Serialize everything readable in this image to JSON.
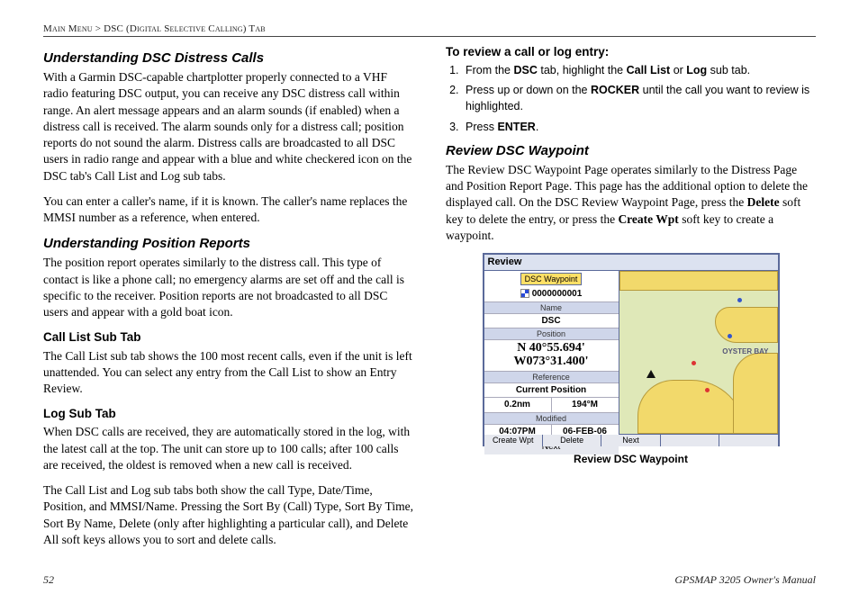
{
  "header": {
    "breadcrumb_pre": "Main Menu > ",
    "breadcrumb_main": "DSC (Digital Selective Calling) Tab"
  },
  "left": {
    "h_distress": "Understanding DSC Distress Calls",
    "p_distress1": "With a Garmin DSC-capable chartplotter properly connected to a VHF radio featuring DSC output, you can receive any DSC distress call within range. An alert message appears and an alarm sounds (if enabled) when a distress call is received. The alarm sounds only for a distress call; position reports do not sound the alarm. Distress calls are broadcasted to all DSC users in radio range and appear with a blue and white checkered icon on the DSC tab's Call List and Log sub tabs.",
    "p_distress2": "You can enter a caller's name, if it is known. The caller's name replaces the MMSI number as a reference, when entered.",
    "h_posrep": "Understanding Position Reports",
    "p_posrep": "The position report operates similarly to the distress call. This type of contact is like a phone call; no emergency alarms are set off and the call is specific to the receiver. Position reports are not broadcasted to all DSC users and appear with a gold boat icon.",
    "h_calllist": "Call List Sub Tab",
    "p_calllist": "The Call List sub tab shows the 100 most recent calls, even if the unit is left unattended. You can select any entry from the Call List to show an Entry Review.",
    "h_log": "Log Sub Tab",
    "p_log1": "When DSC calls are received, they are automatically stored in the log, with the latest call at the top. The unit can store up to 100 calls; after 100 calls are received, the oldest is removed when a new call is received.",
    "p_log2": "The Call List and Log sub tabs both show the call Type, Date/Time, Position, and MMSI/Name. Pressing the Sort By (Call) Type, Sort By Time, Sort By Name, Delete (only after highlighting a particular call), and Delete All soft keys allows you to sort and delete calls."
  },
  "right": {
    "h_review_proc": "To review a call or log entry:",
    "steps": [
      {
        "pre": "From the ",
        "b1": "DSC",
        "mid": " tab, highlight the ",
        "b2": "Call List",
        "mid2": " or ",
        "b3": "Log",
        "post": " sub tab."
      },
      {
        "pre": "Press up or down on the ",
        "b1": "ROCKER",
        "post": " until the call you want to review is highlighted."
      },
      {
        "pre": "Press ",
        "b1": "ENTER",
        "post": "."
      }
    ],
    "h_reviewwpt": "Review DSC Waypoint",
    "p_reviewwpt": "The Review DSC Waypoint Page operates similarly to the Distress Page and Position Report Page. This page has the additional option to delete the displayed call. On the DSC Review Waypoint Page, press the Delete soft key to delete the entry, or press the Create Wpt soft key to create a waypoint.",
    "p_reviewwpt_b1": "Delete",
    "p_reviewwpt_b2": "Create Wpt",
    "fig": {
      "title": "Review",
      "tab": "DSC  Waypoint",
      "mmsi": "0000000001",
      "lbl_name": "Name",
      "name": "DSC",
      "lbl_position": "Position",
      "pos_n": "N  40°55.694'",
      "pos_w": "W073°31.400'",
      "lbl_reference": "Reference",
      "reference": "Current Position",
      "dist": "0.2nm",
      "brg_suffix": "194°M",
      "lbl_modified": "Modified",
      "time": "04:07PM",
      "date": "06-FEB-06",
      "next": "Next",
      "btn1": "Create Wpt",
      "btn2": "Delete",
      "btn3": "Next",
      "map_label1": "OYSTER BAY",
      "caption": "Review DSC Waypoint"
    }
  },
  "footer": {
    "page": "52",
    "manual": "GPSMAP 3205 Owner's Manual"
  }
}
